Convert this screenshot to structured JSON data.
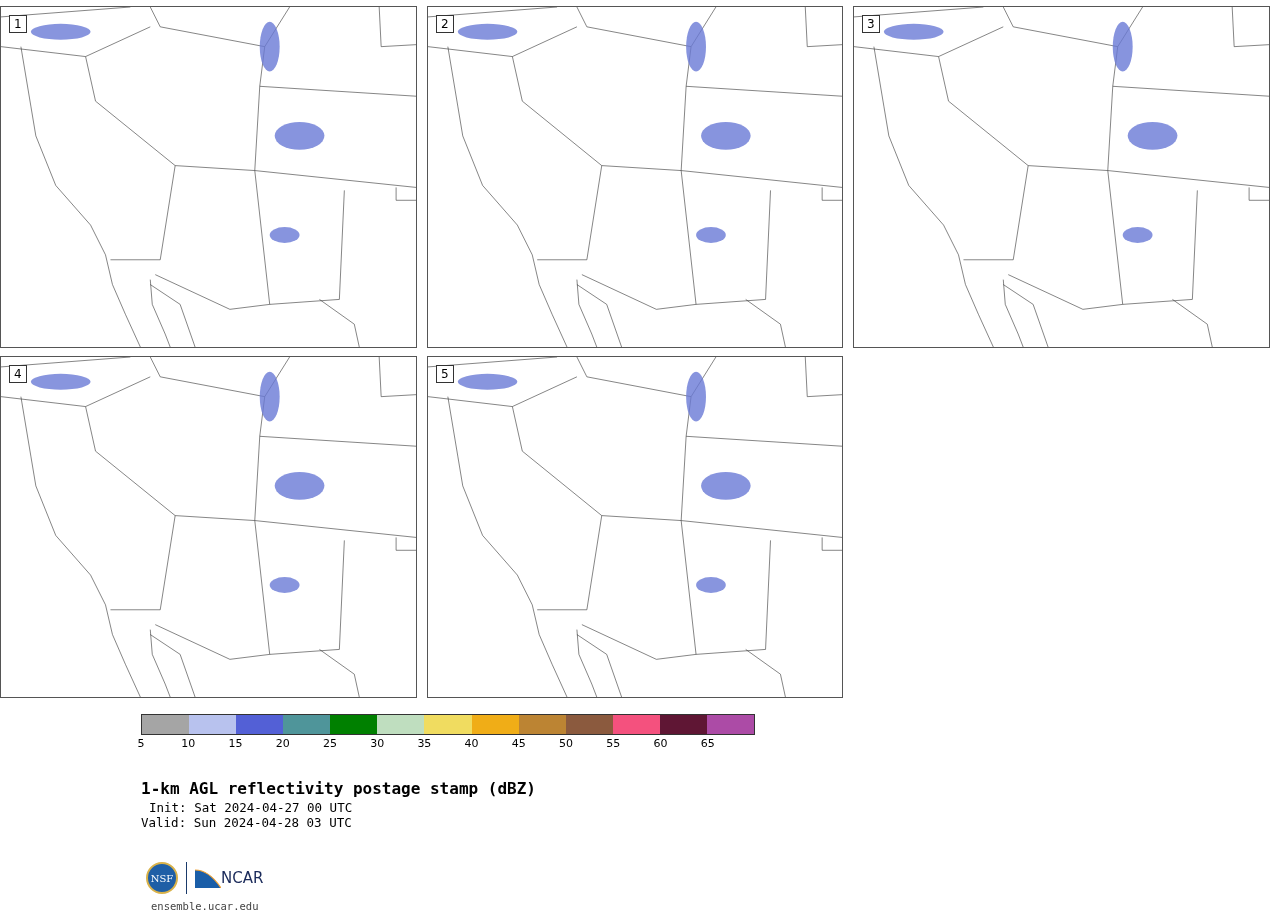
{
  "panels": [
    {
      "label": "1"
    },
    {
      "label": "2"
    },
    {
      "label": "3"
    },
    {
      "label": "4"
    },
    {
      "label": "5"
    }
  ],
  "colorbar": {
    "bins": [
      {
        "color": "#a5a5a5"
      },
      {
        "color": "#b8c2ee"
      },
      {
        "color": "#5360d6"
      },
      {
        "color": "#4f959a"
      },
      {
        "color": "#008000"
      },
      {
        "color": "#bfdebf"
      },
      {
        "color": "#f0dc60"
      },
      {
        "color": "#f0ad17"
      },
      {
        "color": "#bc8433"
      },
      {
        "color": "#8b5a3e"
      },
      {
        "color": "#f4517e"
      },
      {
        "color": "#5f1634"
      },
      {
        "color": "#ac4ba6"
      }
    ],
    "ticks": [
      "5",
      "10",
      "15",
      "20",
      "25",
      "30",
      "35",
      "40",
      "45",
      "50",
      "55",
      "60",
      "65"
    ]
  },
  "title": "1-km AGL reflectivity postage stamp (dBZ)",
  "init": "Init: Sat 2024-04-27 00 UTC",
  "valid": "Valid: Sun 2024-04-28 03 UTC",
  "logo": {
    "left": "NSF",
    "right": "NCAR"
  },
  "url": "ensemble.ucar.edu"
}
